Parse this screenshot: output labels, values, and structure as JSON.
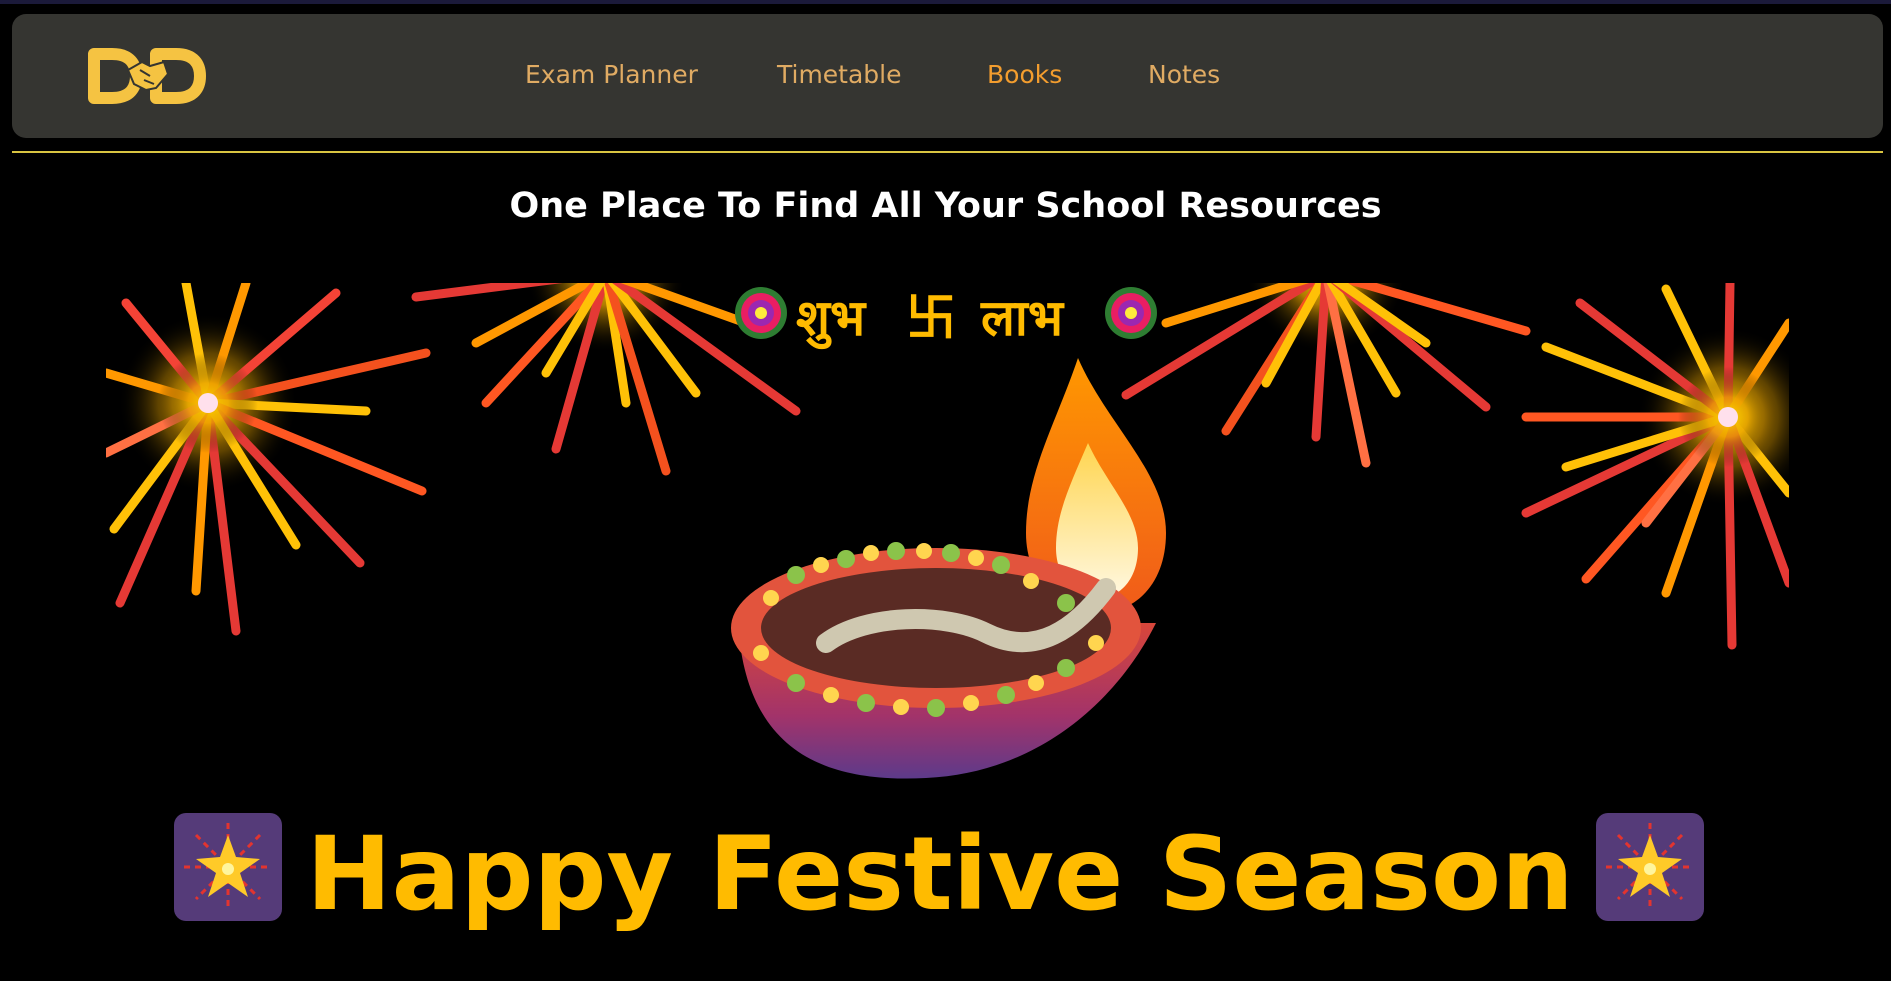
{
  "nav": {
    "logo_alt": "DND",
    "links": [
      {
        "label": "Exam Planner",
        "active": false
      },
      {
        "label": "Timetable",
        "active": false
      },
      {
        "label": "Books",
        "active": true
      },
      {
        "label": "Notes",
        "active": false
      }
    ]
  },
  "main": {
    "headline": "One Place To Find All Your School Resources"
  },
  "banner": {
    "top_text_left": "शुभ",
    "top_text_symbol": "卐",
    "top_text_right": "लाभ",
    "greeting": "Happy Festive Season"
  },
  "colors": {
    "nav_bg": "#353531",
    "nav_link": "#e0ab63",
    "nav_active": "#f39d2e",
    "divider": "#d9c441",
    "greeting": "#ffbb00",
    "logo": "#f5c342"
  },
  "icons": {
    "logo": "handshake-logo-icon",
    "fireworks_badge": "sparkler-icon",
    "lamp": "diya-lamp-icon"
  }
}
